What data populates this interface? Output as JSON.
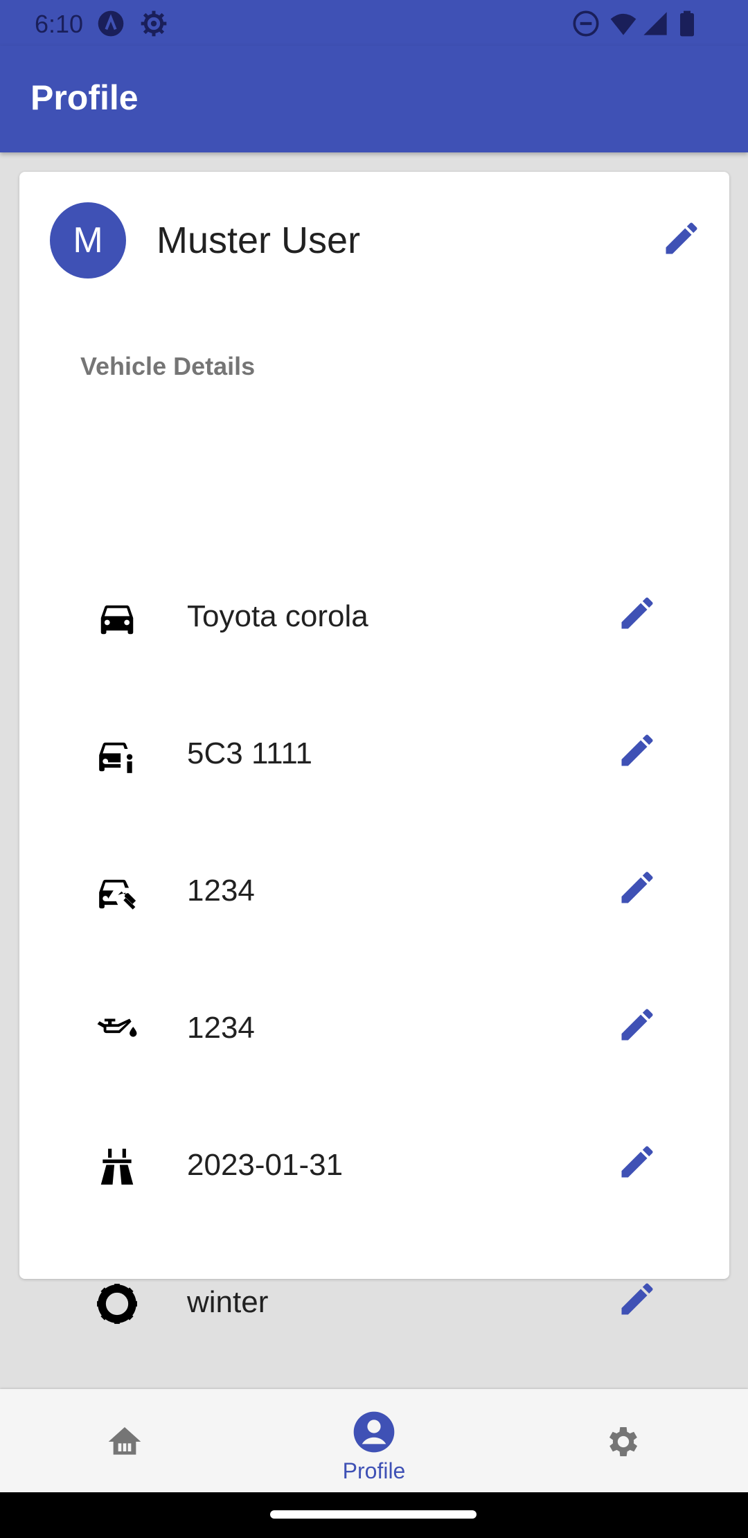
{
  "status_bar": {
    "time": "6:10",
    "icons_left": [
      "a-circle-icon",
      "gear-icon"
    ],
    "icons_right": [
      "dnd-icon",
      "wifi-icon",
      "signal-icon",
      "battery-icon"
    ]
  },
  "app_bar": {
    "title": "Profile"
  },
  "profile": {
    "avatar_letter": "M",
    "name": "Muster User"
  },
  "vehicle": {
    "section_label": "Vehicle Details",
    "items": [
      {
        "icon": "car-icon",
        "value": "Toyota corola"
      },
      {
        "icon": "car-info-icon",
        "value": "5C3 1111"
      },
      {
        "icon": "car-repair-icon",
        "value": "1234"
      },
      {
        "icon": "oil-can-icon",
        "value": "1234"
      },
      {
        "icon": "road-icon",
        "value": "2023-01-31"
      },
      {
        "icon": "tire-icon",
        "value": "winter"
      }
    ]
  },
  "bottom_nav": {
    "items": [
      {
        "icon": "home-icon",
        "label": ""
      },
      {
        "icon": "account-circle-icon",
        "label": "Profile"
      },
      {
        "icon": "settings-icon",
        "label": ""
      }
    ]
  },
  "colors": {
    "primary": "#3f51b5",
    "background": "#e0e0e0",
    "card": "#ffffff",
    "nav_bg": "#f5f5f5"
  }
}
